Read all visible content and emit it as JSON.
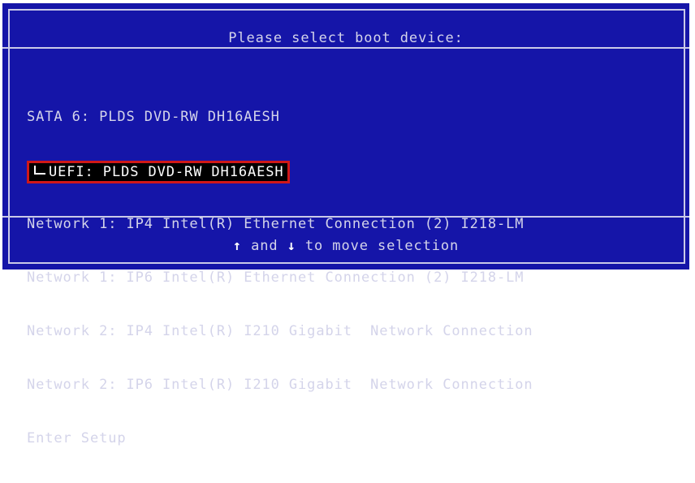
{
  "header": {
    "title": "Please select boot device:"
  },
  "boot_devices": [
    {
      "label": "SATA 6: PLDS DVD-RW DH16AESH",
      "selected": false
    },
    {
      "label": "UEFI: PLDS DVD-RW DH16AESH",
      "selected": true
    },
    {
      "label": "Network 1: IP4 Intel(R) Ethernet Connection (2) I218-LM",
      "selected": false
    },
    {
      "label": "Network 1: IP6 Intel(R) Ethernet Connection (2) I218-LM",
      "selected": false
    },
    {
      "label": "Network 2: IP4 Intel(R) I210 Gigabit  Network Connection",
      "selected": false
    },
    {
      "label": "Network 2: IP6 Intel(R) I210 Gigabit  Network Connection",
      "selected": false
    },
    {
      "label": "Enter Setup",
      "selected": false
    }
  ],
  "footer": {
    "up_arrow": "↑",
    "conj": " and ",
    "down_arrow": "↓",
    "hint": " to move selection"
  },
  "colors": {
    "background": "#1515a8",
    "text": "#d4d4ea",
    "selection_bg": "#000000",
    "selection_border": "#d01818"
  }
}
